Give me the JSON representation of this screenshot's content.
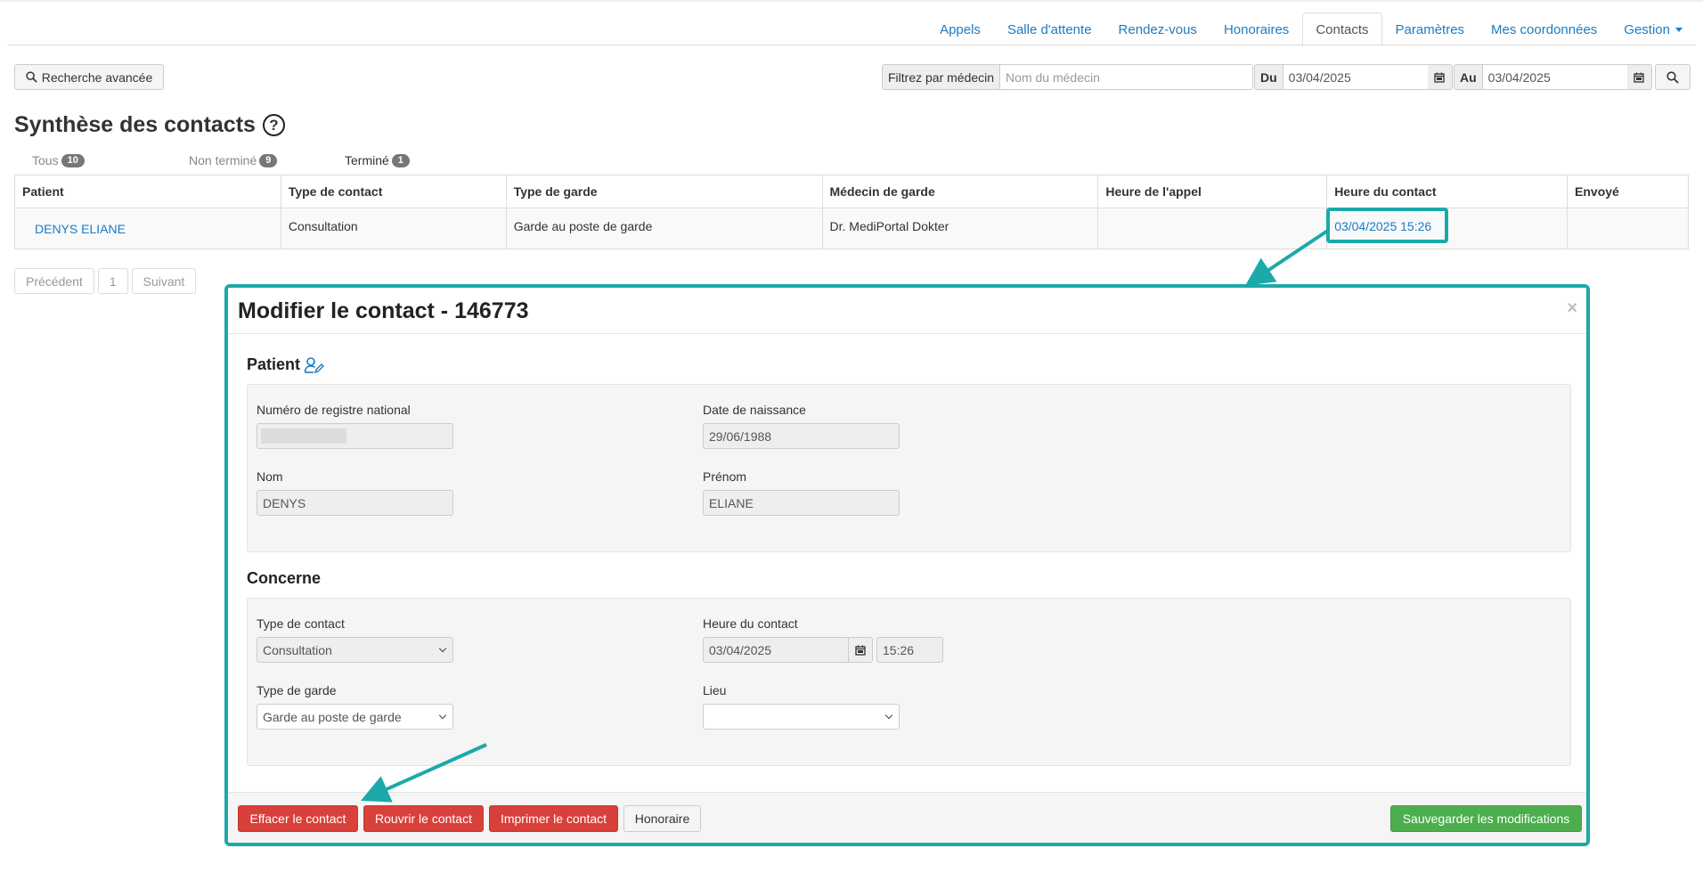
{
  "nav": {
    "items": [
      {
        "label": "Appels"
      },
      {
        "label": "Salle d'attente"
      },
      {
        "label": "Rendez-vous"
      },
      {
        "label": "Honoraires"
      },
      {
        "label": "Contacts"
      },
      {
        "label": "Paramètres"
      },
      {
        "label": "Mes coordonnées"
      },
      {
        "label": "Gestion"
      }
    ],
    "active": "Contacts"
  },
  "toolbar": {
    "advanced_search_label": "Recherche avancée",
    "filter_doctor_label": "Filtrez par médecin",
    "doctor_placeholder": "Nom du médecin",
    "from_label": "Du",
    "from_date": "03/04/2025",
    "to_label": "Au",
    "to_date": "03/04/2025"
  },
  "page": {
    "title": "Synthèse des contacts",
    "help_glyph": "?"
  },
  "status_tabs": [
    {
      "label": "Tous",
      "count": "10"
    },
    {
      "label": "Non terminé",
      "count": "9"
    },
    {
      "label": "Terminé",
      "count": "1"
    }
  ],
  "table": {
    "headers": [
      "Patient",
      "Type de contact",
      "Type de garde",
      "Médecin de garde",
      "Heure de l'appel",
      "Heure du contact",
      "Envoyé"
    ],
    "rows": [
      {
        "patient": "DENYS ELIANE",
        "type_contact": "Consultation",
        "type_garde": "Garde au poste de garde",
        "medecin": "Dr. MediPortal Dokter",
        "heure_appel": "",
        "heure_contact": "03/04/2025 15:26",
        "envoye": ""
      }
    ]
  },
  "pagination": {
    "prev": "Précédent",
    "page": "1",
    "next": "Suivant"
  },
  "modal": {
    "title": "Modifier le contact - 146773",
    "close": "×",
    "patient_section": {
      "title": "Patient",
      "nrn_label": "Numéro de registre national",
      "dob_label": "Date de naissance",
      "dob_value": "29/06/1988",
      "nom_label": "Nom",
      "nom_value": "DENYS",
      "prenom_label": "Prénom",
      "prenom_value": "ELIANE"
    },
    "concerne_section": {
      "title": "Concerne",
      "type_contact_label": "Type de contact",
      "type_contact_value": "Consultation",
      "heure_contact_label": "Heure du contact",
      "heure_date_value": "03/04/2025",
      "heure_time_value": "15:26",
      "type_garde_label": "Type de garde",
      "type_garde_value": "Garde au poste de garde",
      "lieu_label": "Lieu",
      "lieu_value": ""
    },
    "footer": {
      "delete_label": "Effacer le contact",
      "reopen_label": "Rouvrir le contact",
      "print_label": "Imprimer le contact",
      "fee_label": "Honoraire",
      "save_label": "Sauvegarder les modifications"
    }
  },
  "colors": {
    "link": "#1b7cc4",
    "annotation": "#1ca9a9",
    "danger": "#d9403a",
    "success": "#4cae4c"
  }
}
